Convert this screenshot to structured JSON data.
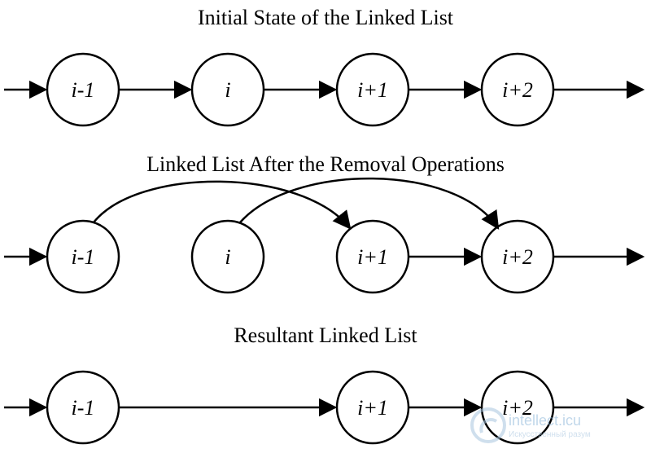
{
  "titles": {
    "initial": "Initial State of the Linked List",
    "removal": "Linked List After the Removal Operations",
    "result": "Resultant Linked List"
  },
  "node_labels": {
    "im1": "i-1",
    "i": "i",
    "ip1": "i+1",
    "ip2": "i+2"
  },
  "chart_data": {
    "type": "diagram",
    "description": "Three panels showing removal of a node from a singly linked list.",
    "panels": [
      {
        "title": "Initial State of the Linked List",
        "nodes": [
          "i-1",
          "i",
          "i+1",
          "i+2"
        ],
        "edges": [
          {
            "from": null,
            "to": "i-1",
            "kind": "straight"
          },
          {
            "from": "i-1",
            "to": "i",
            "kind": "straight"
          },
          {
            "from": "i",
            "to": "i+1",
            "kind": "straight"
          },
          {
            "from": "i+1",
            "to": "i+2",
            "kind": "straight"
          },
          {
            "from": "i+2",
            "to": null,
            "kind": "straight"
          }
        ]
      },
      {
        "title": "Linked List After the Removal Operations",
        "nodes": [
          "i-1",
          "i",
          "i+1",
          "i+2"
        ],
        "edges": [
          {
            "from": null,
            "to": "i-1",
            "kind": "straight"
          },
          {
            "from": "i-1",
            "to": "i+1",
            "kind": "arc"
          },
          {
            "from": "i",
            "to": "i+2",
            "kind": "arc"
          },
          {
            "from": "i+1",
            "to": "i+2",
            "kind": "straight"
          },
          {
            "from": "i+2",
            "to": null,
            "kind": "straight"
          }
        ]
      },
      {
        "title": "Resultant Linked List",
        "nodes": [
          "i-1",
          "i+1",
          "i+2"
        ],
        "edges": [
          {
            "from": null,
            "to": "i-1",
            "kind": "straight"
          },
          {
            "from": "i-1",
            "to": "i+1",
            "kind": "straight"
          },
          {
            "from": "i+1",
            "to": "i+2",
            "kind": "straight"
          },
          {
            "from": "i+2",
            "to": null,
            "kind": "straight"
          }
        ]
      }
    ]
  },
  "watermark": {
    "line1": "intellect.icu",
    "line2": "Искусственный разум"
  }
}
